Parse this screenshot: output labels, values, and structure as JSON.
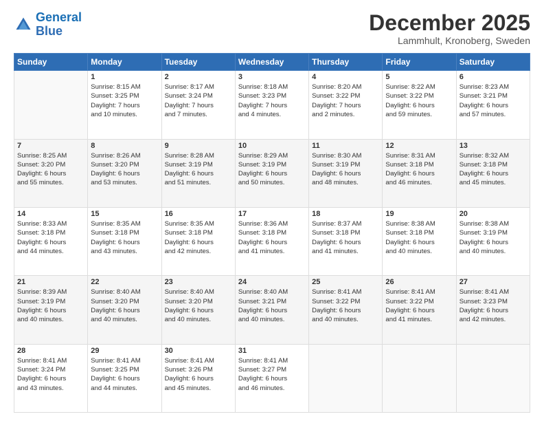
{
  "header": {
    "logo_line1": "General",
    "logo_line2": "Blue",
    "month": "December 2025",
    "location": "Lammhult, Kronoberg, Sweden"
  },
  "days_header": [
    "Sunday",
    "Monday",
    "Tuesday",
    "Wednesday",
    "Thursday",
    "Friday",
    "Saturday"
  ],
  "weeks": [
    [
      {
        "day": "",
        "info": ""
      },
      {
        "day": "1",
        "info": "Sunrise: 8:15 AM\nSunset: 3:25 PM\nDaylight: 7 hours\nand 10 minutes."
      },
      {
        "day": "2",
        "info": "Sunrise: 8:17 AM\nSunset: 3:24 PM\nDaylight: 7 hours\nand 7 minutes."
      },
      {
        "day": "3",
        "info": "Sunrise: 8:18 AM\nSunset: 3:23 PM\nDaylight: 7 hours\nand 4 minutes."
      },
      {
        "day": "4",
        "info": "Sunrise: 8:20 AM\nSunset: 3:22 PM\nDaylight: 7 hours\nand 2 minutes."
      },
      {
        "day": "5",
        "info": "Sunrise: 8:22 AM\nSunset: 3:22 PM\nDaylight: 6 hours\nand 59 minutes."
      },
      {
        "day": "6",
        "info": "Sunrise: 8:23 AM\nSunset: 3:21 PM\nDaylight: 6 hours\nand 57 minutes."
      }
    ],
    [
      {
        "day": "7",
        "info": "Sunrise: 8:25 AM\nSunset: 3:20 PM\nDaylight: 6 hours\nand 55 minutes."
      },
      {
        "day": "8",
        "info": "Sunrise: 8:26 AM\nSunset: 3:20 PM\nDaylight: 6 hours\nand 53 minutes."
      },
      {
        "day": "9",
        "info": "Sunrise: 8:28 AM\nSunset: 3:19 PM\nDaylight: 6 hours\nand 51 minutes."
      },
      {
        "day": "10",
        "info": "Sunrise: 8:29 AM\nSunset: 3:19 PM\nDaylight: 6 hours\nand 50 minutes."
      },
      {
        "day": "11",
        "info": "Sunrise: 8:30 AM\nSunset: 3:19 PM\nDaylight: 6 hours\nand 48 minutes."
      },
      {
        "day": "12",
        "info": "Sunrise: 8:31 AM\nSunset: 3:18 PM\nDaylight: 6 hours\nand 46 minutes."
      },
      {
        "day": "13",
        "info": "Sunrise: 8:32 AM\nSunset: 3:18 PM\nDaylight: 6 hours\nand 45 minutes."
      }
    ],
    [
      {
        "day": "14",
        "info": "Sunrise: 8:33 AM\nSunset: 3:18 PM\nDaylight: 6 hours\nand 44 minutes."
      },
      {
        "day": "15",
        "info": "Sunrise: 8:35 AM\nSunset: 3:18 PM\nDaylight: 6 hours\nand 43 minutes."
      },
      {
        "day": "16",
        "info": "Sunrise: 8:35 AM\nSunset: 3:18 PM\nDaylight: 6 hours\nand 42 minutes."
      },
      {
        "day": "17",
        "info": "Sunrise: 8:36 AM\nSunset: 3:18 PM\nDaylight: 6 hours\nand 41 minutes."
      },
      {
        "day": "18",
        "info": "Sunrise: 8:37 AM\nSunset: 3:18 PM\nDaylight: 6 hours\nand 41 minutes."
      },
      {
        "day": "19",
        "info": "Sunrise: 8:38 AM\nSunset: 3:18 PM\nDaylight: 6 hours\nand 40 minutes."
      },
      {
        "day": "20",
        "info": "Sunrise: 8:38 AM\nSunset: 3:19 PM\nDaylight: 6 hours\nand 40 minutes."
      }
    ],
    [
      {
        "day": "21",
        "info": "Sunrise: 8:39 AM\nSunset: 3:19 PM\nDaylight: 6 hours\nand 40 minutes."
      },
      {
        "day": "22",
        "info": "Sunrise: 8:40 AM\nSunset: 3:20 PM\nDaylight: 6 hours\nand 40 minutes."
      },
      {
        "day": "23",
        "info": "Sunrise: 8:40 AM\nSunset: 3:20 PM\nDaylight: 6 hours\nand 40 minutes."
      },
      {
        "day": "24",
        "info": "Sunrise: 8:40 AM\nSunset: 3:21 PM\nDaylight: 6 hours\nand 40 minutes."
      },
      {
        "day": "25",
        "info": "Sunrise: 8:41 AM\nSunset: 3:22 PM\nDaylight: 6 hours\nand 40 minutes."
      },
      {
        "day": "26",
        "info": "Sunrise: 8:41 AM\nSunset: 3:22 PM\nDaylight: 6 hours\nand 41 minutes."
      },
      {
        "day": "27",
        "info": "Sunrise: 8:41 AM\nSunset: 3:23 PM\nDaylight: 6 hours\nand 42 minutes."
      }
    ],
    [
      {
        "day": "28",
        "info": "Sunrise: 8:41 AM\nSunset: 3:24 PM\nDaylight: 6 hours\nand 43 minutes."
      },
      {
        "day": "29",
        "info": "Sunrise: 8:41 AM\nSunset: 3:25 PM\nDaylight: 6 hours\nand 44 minutes."
      },
      {
        "day": "30",
        "info": "Sunrise: 8:41 AM\nSunset: 3:26 PM\nDaylight: 6 hours\nand 45 minutes."
      },
      {
        "day": "31",
        "info": "Sunrise: 8:41 AM\nSunset: 3:27 PM\nDaylight: 6 hours\nand 46 minutes."
      },
      {
        "day": "",
        "info": ""
      },
      {
        "day": "",
        "info": ""
      },
      {
        "day": "",
        "info": ""
      }
    ]
  ]
}
